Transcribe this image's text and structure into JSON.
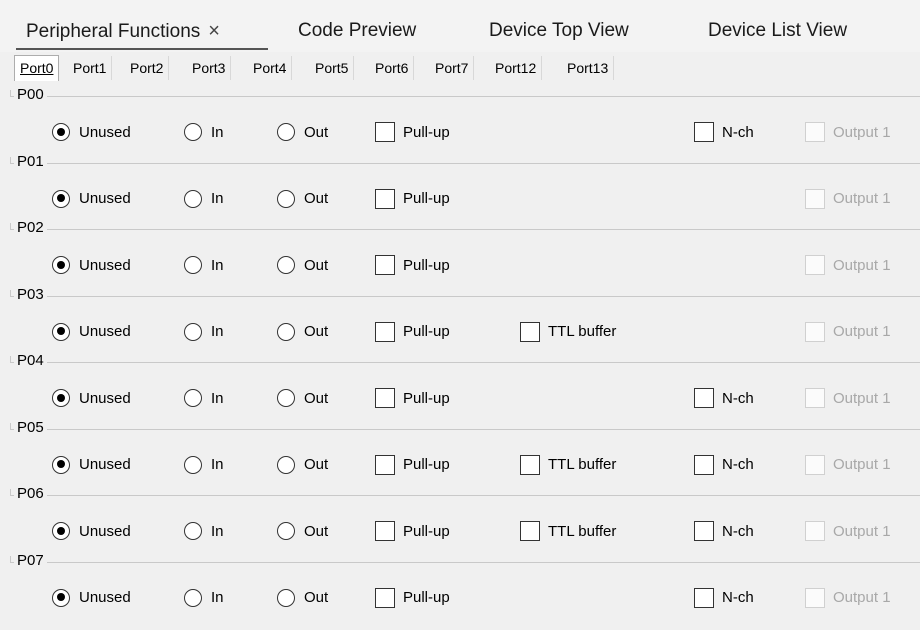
{
  "top_tabs": [
    {
      "label": "Peripheral Functions",
      "close": "×",
      "active": true
    },
    {
      "label": "Code Preview"
    },
    {
      "label": "Device Top View"
    },
    {
      "label": "Device List View"
    }
  ],
  "port_tabs": [
    "Port0",
    "Port1",
    "Port2",
    "Port3",
    "Port4",
    "Port5",
    "Port6",
    "Port7",
    "Port12",
    "Port13"
  ],
  "labels": {
    "unused": "Unused",
    "in": "In",
    "out": "Out",
    "pullup": "Pull-up",
    "ttl": "TTL buffer",
    "nch": "N-ch",
    "output1": "Output 1"
  },
  "pins": [
    {
      "name": "P00",
      "selected": "unused",
      "ttl": false,
      "nch": true
    },
    {
      "name": "P01",
      "selected": "unused",
      "ttl": false,
      "nch": false
    },
    {
      "name": "P02",
      "selected": "unused",
      "ttl": false,
      "nch": false
    },
    {
      "name": "P03",
      "selected": "unused",
      "ttl": true,
      "nch": false
    },
    {
      "name": "P04",
      "selected": "unused",
      "ttl": false,
      "nch": true
    },
    {
      "name": "P05",
      "selected": "unused",
      "ttl": true,
      "nch": true
    },
    {
      "name": "P06",
      "selected": "unused",
      "ttl": true,
      "nch": true
    },
    {
      "name": "P07",
      "selected": "unused",
      "ttl": false,
      "nch": true
    }
  ]
}
